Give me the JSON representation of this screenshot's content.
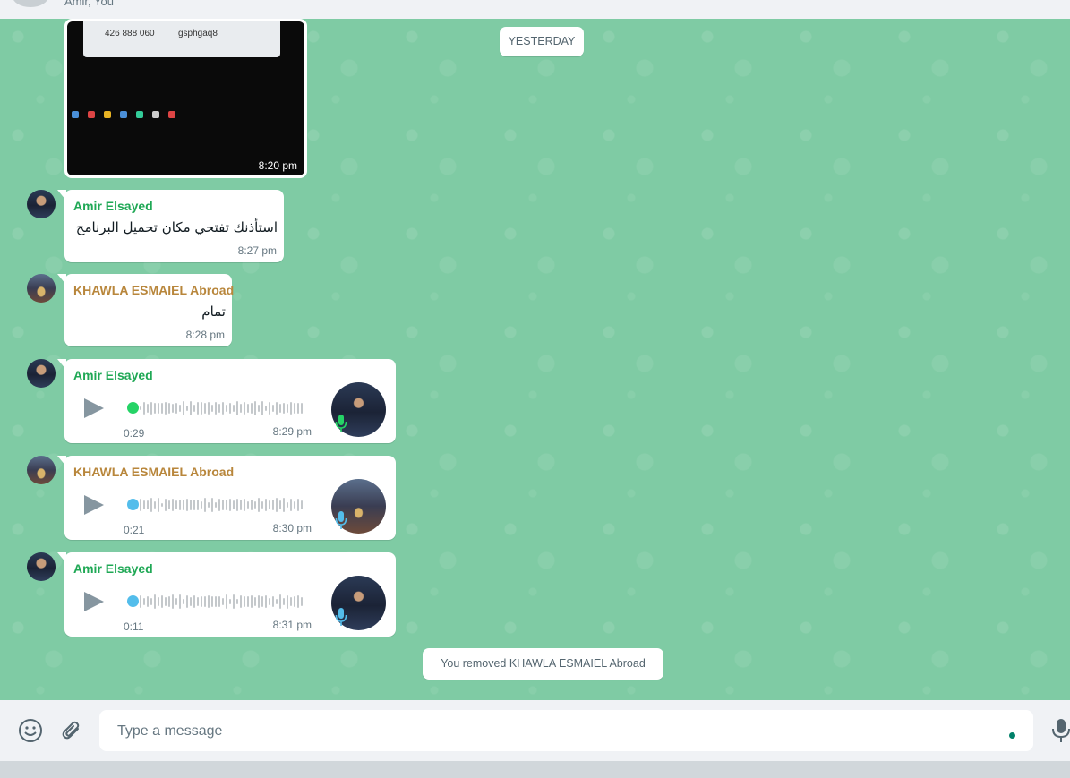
{
  "header": {
    "subtitle": "Amir, You"
  },
  "date_divider": "YESTERDAY",
  "image_message": {
    "time": "8:20 pm",
    "screen_text_left": "426 888 060",
    "screen_text_right": "gsphgaq8"
  },
  "messages": [
    {
      "sender": "Amir Elsayed",
      "text": "استأذنك تفتحي مكان تحميل البرنامج",
      "time": "8:27 pm"
    },
    {
      "sender": "KHAWLA ESMAIEL Abroad",
      "text": "تمام",
      "time": "8:28 pm"
    }
  ],
  "voice_messages": [
    {
      "sender": "Amir Elsayed",
      "duration": "0:29",
      "time": "8:29 pm",
      "dot_color": "#25d366"
    },
    {
      "sender": "KHAWLA ESMAIEL Abroad",
      "duration": "0:21",
      "time": "8:30 pm",
      "dot_color": "#53bdeb"
    },
    {
      "sender": "Amir Elsayed",
      "duration": "0:11",
      "time": "8:31 pm",
      "dot_color": "#53bdeb"
    }
  ],
  "system_message": "You removed KHAWLA ESMAIEL Abroad",
  "composer": {
    "placeholder": "Type a message"
  },
  "colors": {
    "chat_background": "#7fcba4",
    "sender_amir": "#1fa855",
    "sender_khawla": "#b8863b",
    "accent": "#008069"
  },
  "icons": [
    "emoji-icon",
    "attach-icon",
    "mic-icon",
    "play-icon"
  ]
}
